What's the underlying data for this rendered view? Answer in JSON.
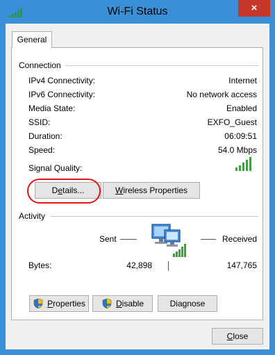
{
  "window": {
    "title": "Wi-Fi Status",
    "close_glyph": "×"
  },
  "tabs": [
    {
      "label": "General"
    }
  ],
  "connection": {
    "group_label": "Connection",
    "rows": [
      {
        "label": "IPv4 Connectivity:",
        "value": "Internet"
      },
      {
        "label": "IPv6 Connectivity:",
        "value": "No network access"
      },
      {
        "label": "Media State:",
        "value": "Enabled"
      },
      {
        "label": "SSID:",
        "value": "EXFO_Guest"
      },
      {
        "label": "Duration:",
        "value": "06:09:51"
      },
      {
        "label": "Speed:",
        "value": "54.0 Mbps"
      }
    ],
    "signal_label": "Signal Quality:",
    "signal_level": 1.0,
    "details_button": {
      "pre": "D",
      "underline": "e",
      "post": "tails..."
    },
    "wireless_button": {
      "underline": "W",
      "post": "ireless Properties"
    }
  },
  "activity": {
    "group_label": "Activity",
    "sent_label": "Sent",
    "received_label": "Received",
    "bytes_label": "Bytes:",
    "bytes_sent": "42,898",
    "bytes_received": "147,765"
  },
  "actions": {
    "properties": {
      "underline": "P",
      "post": "roperties"
    },
    "disable": {
      "underline": "D",
      "post": "isable"
    },
    "diagnose": {
      "pre": "Dia",
      "underline": "g",
      "post": "nose"
    }
  },
  "footer": {
    "close": {
      "underline": "C",
      "post": "lose"
    }
  },
  "icons": {
    "app": "signal-bars-icon",
    "shield": "uac-shield-icon",
    "network": "network-computers-icon"
  },
  "colors": {
    "titlebar": "#3a8fd6",
    "close_button": "#c7382c",
    "highlight_ring": "#e0161b",
    "signal_green": "#3aa33a"
  }
}
